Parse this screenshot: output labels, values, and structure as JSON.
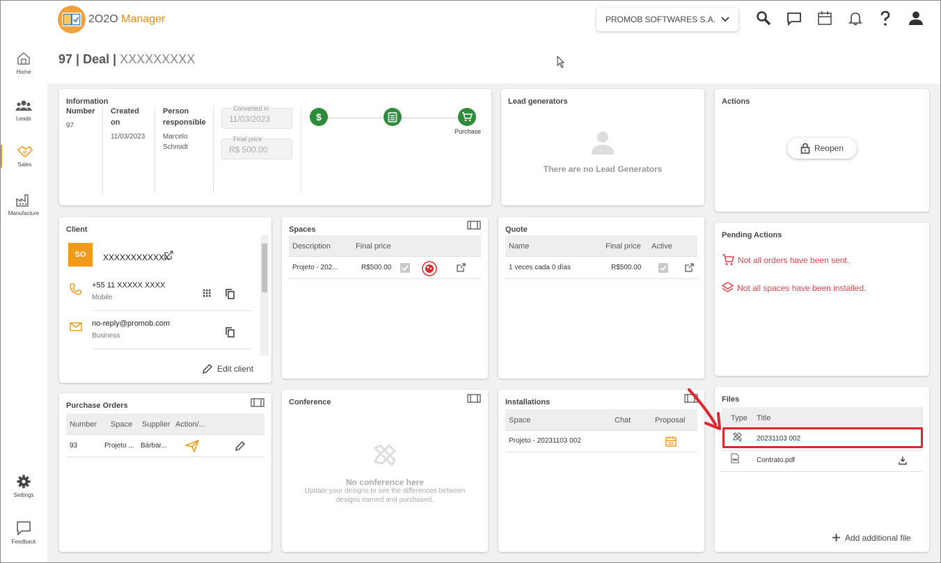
{
  "app": {
    "name_part1": "2O2O",
    "name_part2": "Manager"
  },
  "sidebar": {
    "items": [
      {
        "label": "Home"
      },
      {
        "label": "Leads"
      },
      {
        "label": "Sales"
      },
      {
        "label": "Manufacture"
      },
      {
        "label": "Settings"
      },
      {
        "label": "Feedback"
      }
    ]
  },
  "header": {
    "company": "PROMOB SOFTWARES S.A."
  },
  "page": {
    "number": "97",
    "type": "Deal",
    "separator": "|",
    "name": "XXXXXXXXX"
  },
  "information": {
    "title": "Information",
    "number_label": "Number",
    "number": "97",
    "created_label_1": "Created",
    "created_label_2": "on",
    "created": "11/03/2023",
    "person_label_1": "Person",
    "person_label_2": "responsible",
    "person_1": "Marcelo",
    "person_2": "Schmidt",
    "converted_label": "Converted in",
    "converted": "11/03/2023",
    "final_price_label": "Final price",
    "final_price": "R$ 500.00",
    "step_label": "Purchase",
    "step_symbol": "$"
  },
  "lead_generators": {
    "title": "Lead generators",
    "empty": "There are no Lead Generators"
  },
  "actions": {
    "title": "Actions",
    "reopen": "Reopen"
  },
  "client": {
    "title": "Client",
    "initials": "SO",
    "name": "XXXXXXXXXXXX",
    "phone": "+55 11 XXXXX XXXX",
    "phone_type": "Mobile",
    "email": "no-reply@promob.com",
    "email_type": "Business",
    "edit": "Edit client"
  },
  "spaces": {
    "title": "Spaces",
    "columns": [
      "Description",
      "Final price"
    ],
    "rows": [
      {
        "description": "Projeto - 202...",
        "price": "R$500.00"
      }
    ]
  },
  "quote": {
    "title": "Quote",
    "columns": [
      "Name",
      "Final price",
      "Active"
    ],
    "rows": [
      {
        "name": "1 veces cada 0 días",
        "price": "R$500.00"
      }
    ]
  },
  "pending": {
    "title": "Pending Actions",
    "items": [
      "Not all orders have been sent.",
      "Not all spaces have been installed."
    ]
  },
  "purchase_orders": {
    "title": "Purchase Orders",
    "columns": [
      "Number",
      "Space",
      "Supplier",
      "Action/..."
    ],
    "rows": [
      {
        "number": "93",
        "space": "Projeto ...",
        "supplier": "Bárbar..."
      }
    ]
  },
  "conference": {
    "title": "Conference",
    "empty_title": "No conference here",
    "empty_text_1": "Update your designs to see the differences between",
    "empty_text_2": "designs earned and purchased."
  },
  "installations": {
    "title": "Installations",
    "columns": [
      "Space",
      "Chat",
      "Proposal"
    ],
    "rows": [
      {
        "space": "Projeto - 20231103 002"
      }
    ]
  },
  "files": {
    "title": "Files",
    "columns": [
      "Type",
      "Title"
    ],
    "rows": [
      {
        "title": "20231103 002"
      },
      {
        "title": "Contrato.pdf"
      }
    ],
    "add": "Add additional file"
  },
  "colors": {
    "accent": "#f29a1a",
    "green": "#2e8b3a",
    "alert": "#e0424d",
    "highlight": "#e0242e"
  }
}
